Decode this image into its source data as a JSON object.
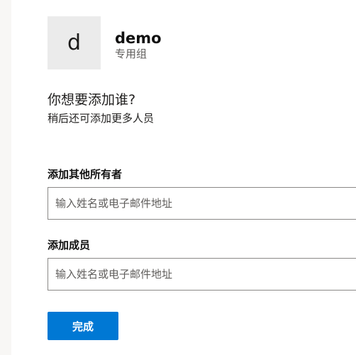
{
  "group": {
    "avatar_letter": "d",
    "name": "demo",
    "type": "专用组"
  },
  "prompt": {
    "title": "你想要添加谁?",
    "subtitle": "稍后还可添加更多人员"
  },
  "owners": {
    "label": "添加其他所有者",
    "placeholder": "输入姓名或电子邮件地址",
    "value": ""
  },
  "members": {
    "label": "添加成员",
    "placeholder": "输入姓名或电子邮件地址",
    "value": ""
  },
  "actions": {
    "done_label": "完成"
  },
  "colors": {
    "primary": "#0078d4",
    "avatar_bg": "#ebebeb",
    "border": "#8a8886"
  }
}
